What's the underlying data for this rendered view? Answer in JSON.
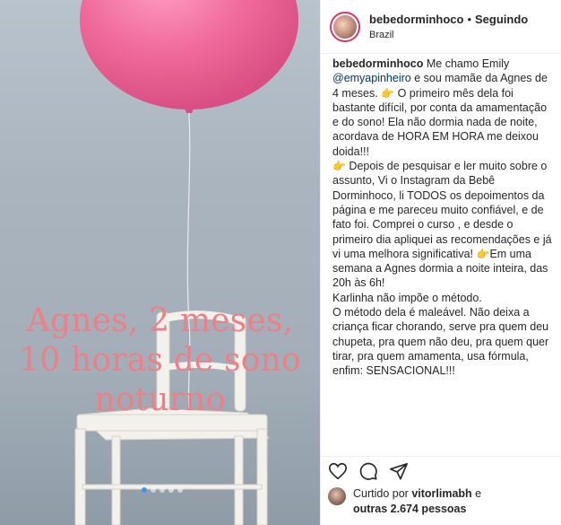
{
  "post": {
    "overlay_lines": [
      "Agnes, 2 meses,",
      "10 horas de sono",
      "noturno"
    ],
    "carousel_active_index": 0,
    "carousel_count": 5
  },
  "header": {
    "username": "bebedorminhoco",
    "separator": "•",
    "follow_status": "Seguindo",
    "location": "Brazil"
  },
  "caption": {
    "username": "bebedorminhoco",
    "part1": " Me chamo Emily ",
    "mention": "@emyapinheiro",
    "part2": " e sou mamãe da Agnes de 4 meses. ",
    "emoji": "👉",
    "part3": " O primeiro mês dela foi bastante difícil, por conta da amamentação e do sono! Ela não dormia nada de noite, acordava de HORA EM HORA  me deixou doida!!!",
    "part4": " Depois de pesquisar e ler muito sobre o assunto, Vi o Instagram da Bebê Dorminhoco, li TODOS os depoimentos da página e me pareceu muito confiável, e de fato foi. Comprei o curso , e desde o primeiro dia apliquei as recomendações e já vi uma melhora significativa!   ",
    "part5": "Em uma semana a Agnes dormia a noite inteira, das 20h às 6h!",
    "part6": "Karlinha não impõe o método.",
    "part7": "O método dela é maleável. Não deixa a criança ficar chorando, serve pra quem deu chupeta, pra quem não deu, pra quem quer tirar, pra quem amamenta, usa fórmula, enfim: SENSACIONAL!!!"
  },
  "likes": {
    "prefix": "Curtido por ",
    "liker": "vitorlimabh",
    "middle": " e ",
    "others": "outras 2.674 pessoas"
  },
  "icons": [
    "heart-icon",
    "comment-icon",
    "share-icon"
  ],
  "colors": {
    "overlay_text": "#ef7f86",
    "balloon": "#f06a9a",
    "mention": "#003569",
    "carousel_active": "#3897f0"
  }
}
